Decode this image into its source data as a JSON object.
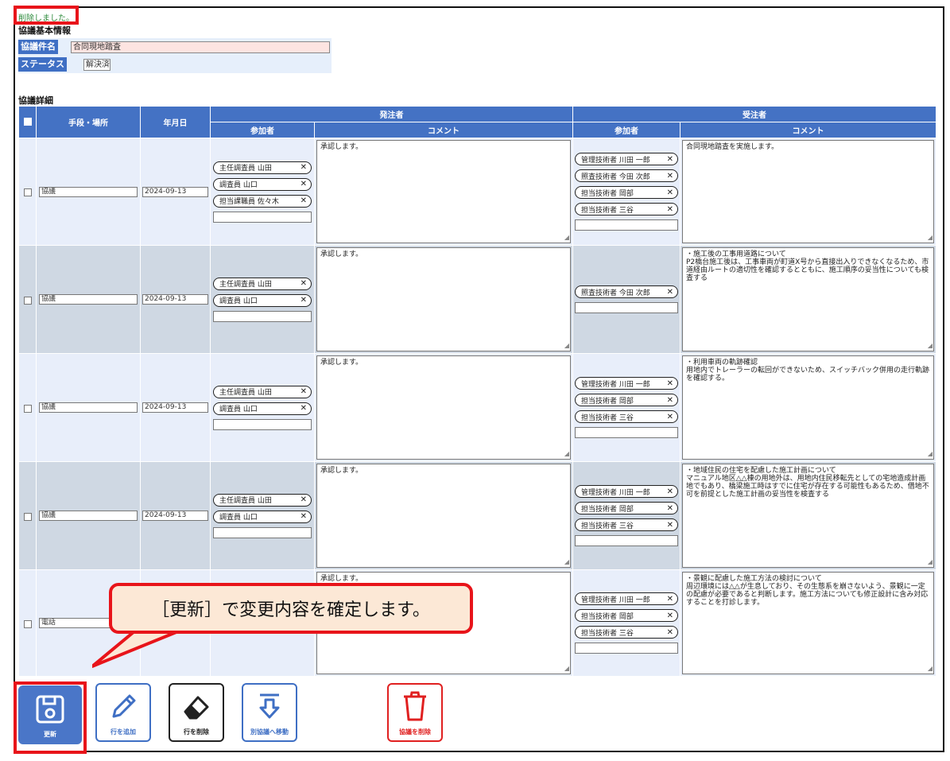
{
  "message": "削除しました。",
  "basic": {
    "section_title": "協議基本情報",
    "name_label": "協議件名",
    "name_value": "合同現地踏査",
    "status_label": "ステータス",
    "status_value": "解決済"
  },
  "detail": {
    "section_title": "協議詳細",
    "headers": {
      "step": "手段・場所",
      "date": "年月日",
      "orderer": "発注者",
      "contractor": "受注者",
      "participants": "参加者",
      "comment": "コメント"
    },
    "rows": [
      {
        "step": "協議",
        "date": "2024-09-13",
        "orderer_participants": [
          "主任調査員 山田",
          "調査員 山口",
          "担当課職員 佐々木"
        ],
        "orderer_comment": "承認します。",
        "contractor_participants": [
          "管理技術者 川田 一郎",
          "照査技術者 今田 次郎",
          "担当技術者 岡部",
          "担当技術者 三谷"
        ],
        "contractor_comment": "合同現地踏査を実施します。"
      },
      {
        "step": "協議",
        "date": "2024-09-13",
        "orderer_participants": [
          "主任調査員 山田",
          "調査員 山口"
        ],
        "orderer_comment": "承認します。",
        "contractor_participants": [
          "照査技術者 今田 次郎"
        ],
        "contractor_comment": "・施工後の工事用道路について\nP2橋台施工後は、工事車両が町道X号から直接出入りできなくなるため、市道経由ルートの適切性を確認するとともに、施工順序の妥当性についても検査する"
      },
      {
        "step": "協議",
        "date": "2024-09-13",
        "orderer_participants": [
          "主任調査員 山田",
          "調査員 山口"
        ],
        "orderer_comment": "承認します。",
        "contractor_participants": [
          "管理技術者 川田 一郎",
          "担当技術者 岡部",
          "担当技術者 三谷"
        ],
        "contractor_comment": "・利用車両の軌跡確認\n用地内でトレーラーの転回ができないため、スイッチバック併用の走行軌跡を確認する。"
      },
      {
        "step": "協議",
        "date": "2024-09-13",
        "orderer_participants": [
          "主任調査員 山田",
          "調査員 山口"
        ],
        "orderer_comment": "承認します。",
        "contractor_participants": [
          "管理技術者 川田 一郎",
          "担当技術者 岡部",
          "担当技術者 三谷"
        ],
        "contractor_comment": "・地域住民の住宅を配慮した施工計画について\nマニュアル地区△△棟の用地外は、用地内住民移転先としての宅地造成計画地でもあり、橋梁施工時はすでに住宅が存在する可能性もあるため、借地不可を前提とした施工計画の妥当性を検査する"
      },
      {
        "step": "電話",
        "date": "",
        "orderer_participants": [],
        "orderer_comment": "承認します。",
        "contractor_participants": [
          "管理技術者 川田 一郎",
          "担当技術者 岡部",
          "担当技術者 三谷"
        ],
        "contractor_comment": "・景観に配慮した施工方法の検討について\n周辺環境には△△が生息しており、その生態系を崩さないよう、景観に一定の配慮が必要であると判断します。施工方法についても修正設計に含み対応することを打診します。"
      }
    ]
  },
  "toolbar": {
    "update": "更新",
    "add_row": "行を追加",
    "delete_row": "行を削除",
    "move": "別協議へ移動",
    "delete_discussion": "協議を削除"
  },
  "callout": "［更新］で変更内容を確定します。",
  "colors": {
    "accent": "#4472c4",
    "highlight": "#e8141a",
    "callout_bg": "#fce8d6"
  }
}
